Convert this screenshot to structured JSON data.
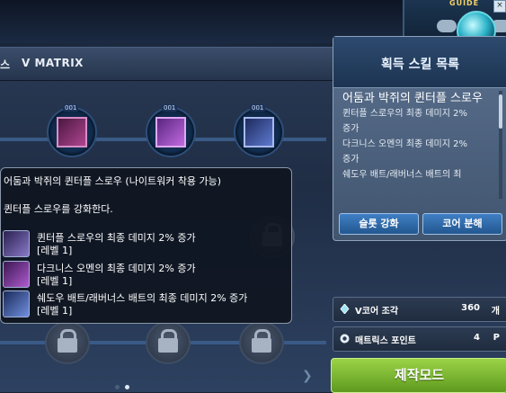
{
  "guide": {
    "label": "GUIDE",
    "close": "×"
  },
  "window": {
    "title_prefix": "스",
    "title": "V MATRIX",
    "close": "×"
  },
  "slots": [
    {
      "level": "001"
    },
    {
      "level": "001"
    },
    {
      "level": "001"
    }
  ],
  "tooltip": {
    "title": "어둠과 박쥐의 퀸터플 스로우 (나이트워커 착용 가능)",
    "description": "퀸터플 스로우를 강화한다.",
    "effects": [
      {
        "line": "퀸터플 스로우의 최종 데미지 2% 증가",
        "level": "[레벨 1]"
      },
      {
        "line": "다크니스 오멘의 최종 데미지 2% 증가",
        "level": "[레벨 1]"
      },
      {
        "line": "쉐도우 배트/래버너스 배트의 최종 데미지 2% 증가",
        "level": "[레벨 1]"
      }
    ]
  },
  "skill_panel": {
    "title": "획득 스킬 목록",
    "skill_name": "어둠과 박쥐의 퀸터플 스로우",
    "lines": [
      "퀸터플 스로우의 최종 데미지 2%",
      "증가",
      "다크니스 오멘의 최종 데미지 2%",
      "증가",
      "쉐도우 배트/래버너스 배트의 최"
    ],
    "slot_upgrade_button": "슬롯 강화",
    "core_disassemble_button": "코어 분해"
  },
  "stats": {
    "v_core_label": "V코어 조각",
    "v_core_value": "360",
    "v_core_unit": "개",
    "matrix_point_label": "매트릭스 포인트",
    "matrix_point_value": "4",
    "matrix_point_unit": "P"
  },
  "craft_button": "제작모드",
  "colors": {
    "accent_blue": "#2f6eb0",
    "craft_green": "#7fbf2f"
  }
}
